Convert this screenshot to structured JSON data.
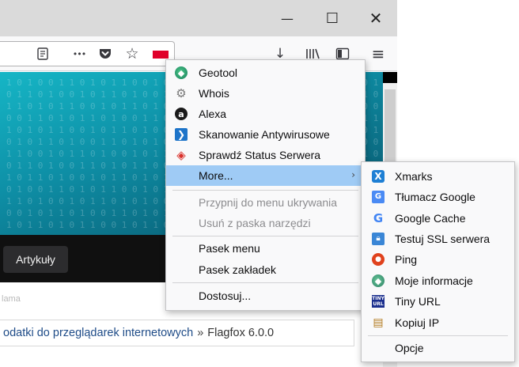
{
  "window": {
    "minimize_glyph": "—",
    "maximize_glyph": "☐",
    "close_glyph": "✕"
  },
  "toolbar": {
    "reader_icon": "reader-view-icon",
    "more_glyph": "•••",
    "pocket_glyph": "◙",
    "star_glyph": "☆",
    "download_glyph": "↓",
    "library_glyph": "lıl\\",
    "sidebar_glyph": "◫",
    "menu_glyph": "≡"
  },
  "page": {
    "category_button": "Artykuły",
    "ad_label": "lama",
    "breadcrumb": {
      "parent": "odatki do przeglądarek internetowych",
      "separator": "»",
      "current": "Flagfox 6.0.0"
    }
  },
  "main_menu": {
    "items": [
      {
        "label": "Geotool",
        "icon": "globe-icon"
      },
      {
        "label": "Whois",
        "icon": "gear-icon"
      },
      {
        "label": "Alexa",
        "icon": "alexa-icon"
      },
      {
        "label": "Skanowanie Antywirusowe",
        "icon": "antivirus-icon"
      },
      {
        "label": "Sprawdź Status Serwera",
        "icon": "server-status-icon"
      },
      {
        "label": "More...",
        "icon": "",
        "arrow": "›"
      }
    ],
    "pin_label": "Przypnij do menu ukrywania",
    "remove_label": "Usuń z paska narzędzi",
    "menubar_label": "Pasek menu",
    "bookmarks_label": "Pasek zakładek",
    "customize_label": "Dostosuj..."
  },
  "sub_menu": {
    "items": [
      {
        "label": "Xmarks",
        "icon": "xmarks-icon"
      },
      {
        "label": "Tłumacz Google",
        "icon": "google-translate-icon"
      },
      {
        "label": "Google Cache",
        "icon": "google-icon"
      },
      {
        "label": "Testuj SSL serwera",
        "icon": "lock-icon"
      },
      {
        "label": "Ping",
        "icon": "ping-icon"
      },
      {
        "label": "Moje informacje",
        "icon": "globe-icon"
      },
      {
        "label": "Tiny URL",
        "icon": "tinyurl-icon"
      },
      {
        "label": "Kopiuj IP",
        "icon": "clipboard-icon"
      }
    ],
    "options_label": "Opcje"
  }
}
